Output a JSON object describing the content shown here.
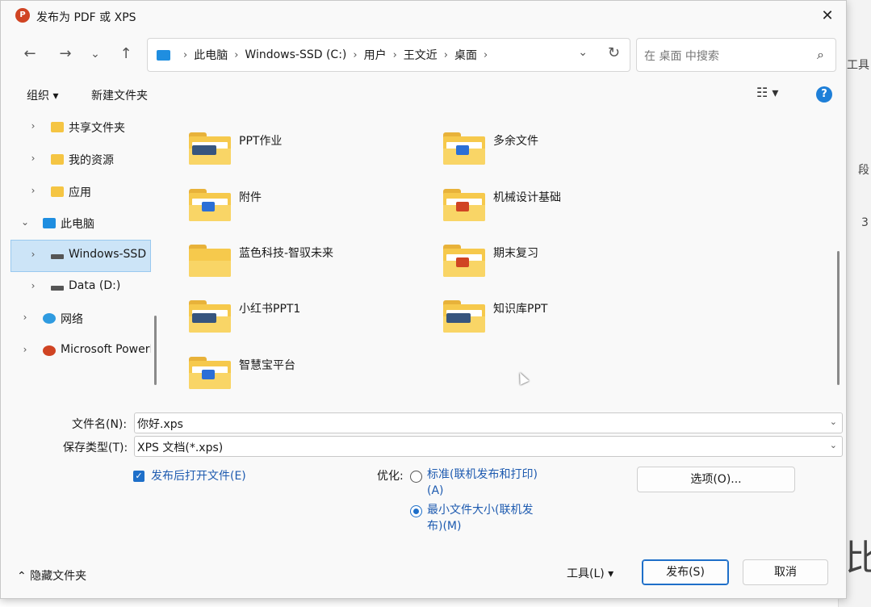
{
  "window": {
    "title": "发布为 PDF 或 XPS",
    "app_icon": "P",
    "close_glyph": "✕"
  },
  "nav_buttons": {
    "back": "←",
    "forward": "→",
    "recent": "⌄",
    "up": "↑"
  },
  "address": {
    "crumbs": [
      "此电脑",
      "Windows-SSD (C:)",
      "用户",
      "王文近",
      "桌面"
    ],
    "separator": "›",
    "dropdown": "⌄",
    "refresh": "↻"
  },
  "search": {
    "placeholder": "在 桌面 中搜索",
    "icon": "⌕"
  },
  "toolbar": {
    "organize": "组织 ▾",
    "new_folder": "新建文件夹",
    "view": "☷ ▾",
    "help": "?"
  },
  "nav_pane": {
    "items": [
      {
        "label": "共享文件夹",
        "icon": "share-folder-icon",
        "chevron": "›"
      },
      {
        "label": "我的资源",
        "icon": "folder-icon",
        "chevron": "›"
      },
      {
        "label": "应用",
        "icon": "folder-icon",
        "chevron": "›"
      },
      {
        "label": "此电脑",
        "icon": "computer-icon",
        "chevron": "⌄"
      },
      {
        "label": "Windows-SSD",
        "icon": "drive-icon",
        "chevron": "›",
        "selected": true
      },
      {
        "label": "Data (D:)",
        "icon": "drive-icon",
        "chevron": "›"
      },
      {
        "label": "网络",
        "icon": "network-icon",
        "chevron": "›"
      },
      {
        "label": "Microsoft PowerPoint",
        "icon": "powerpoint-icon",
        "chevron": "›"
      }
    ]
  },
  "files": [
    {
      "name": "PPT作业",
      "badge": "t"
    },
    {
      "name": "多余文件",
      "badge": "w"
    },
    {
      "name": "附件",
      "badge": "w"
    },
    {
      "name": "机械设计基础",
      "badge": "p"
    },
    {
      "name": "蓝色科技-智驭未来",
      "badge": ""
    },
    {
      "name": "期末复习",
      "badge": "p"
    },
    {
      "name": "小红书PPT1",
      "badge": "t"
    },
    {
      "name": "知识库PPT",
      "badge": "t"
    },
    {
      "name": "智慧宝平台",
      "badge": "w"
    }
  ],
  "form": {
    "filename_label": "文件名(N):",
    "filename_value": "你好.xps",
    "savetype_label": "保存类型(T):",
    "savetype_value": "XPS 文档(*.xps)",
    "dropdown": "⌄",
    "open_after_label": "发布后打开文件(E)",
    "open_after_checked": true,
    "optimize_label": "优化:",
    "opt_standard_line1": "标准(联机发布和打印)",
    "opt_standard_line2": "(A)",
    "opt_min_line1": "最小文件大小(联机发",
    "opt_min_line2": "布)(M)",
    "options_button": "选项(O)..."
  },
  "footer": {
    "hide_folders": "⌃ 隐藏文件夹",
    "tools": "工具(L)   ▾",
    "publish": "发布(S)",
    "cancel": "取消"
  },
  "background_app": {
    "fragments": [
      "F工具",
      "段",
      "3",
      "比"
    ]
  }
}
